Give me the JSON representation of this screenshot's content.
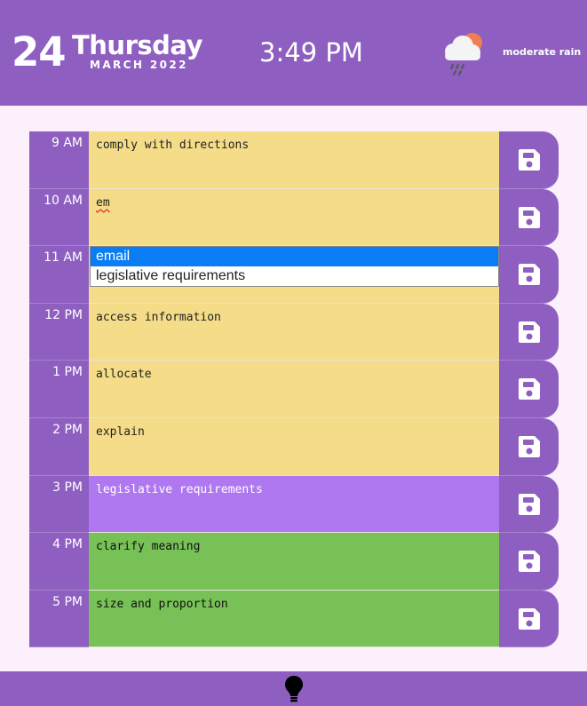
{
  "header": {
    "day_number": "24",
    "day_name": "Thursday",
    "month_year": "MARCH 2022",
    "time": "3:49 PM",
    "weather_description": "moderate rain",
    "weather_icon": "rain-cloud-sun-icon"
  },
  "planner": {
    "rows": [
      {
        "hour": "9 AM",
        "task": "comply with directions",
        "state": "past"
      },
      {
        "hour": "10 AM",
        "task": "em",
        "state": "past"
      },
      {
        "hour": "11 AM",
        "task": "",
        "state": "past"
      },
      {
        "hour": "12 PM",
        "task": "access information",
        "state": "past"
      },
      {
        "hour": "1 PM",
        "task": "allocate",
        "state": "past"
      },
      {
        "hour": "2 PM",
        "task": "explain",
        "state": "past"
      },
      {
        "hour": "3 PM",
        "task": "legislative requirements",
        "state": "present"
      },
      {
        "hour": "4 PM",
        "task": "clarify meaning",
        "state": "future"
      },
      {
        "hour": "5 PM",
        "task": "size and proportion",
        "state": "future"
      }
    ],
    "save_icon": "floppy-disk-icon"
  },
  "autocomplete": {
    "options": [
      "email",
      "legislative requirements"
    ],
    "selected": "email"
  },
  "footer": {
    "icon": "lightbulb-icon"
  },
  "colors": {
    "brand": "#8e5fc1",
    "past": "#f4dc88",
    "present": "#b078f0",
    "future": "#77c157",
    "background": "#fbf0fb",
    "autocomplete_selected": "#0a7df5"
  }
}
